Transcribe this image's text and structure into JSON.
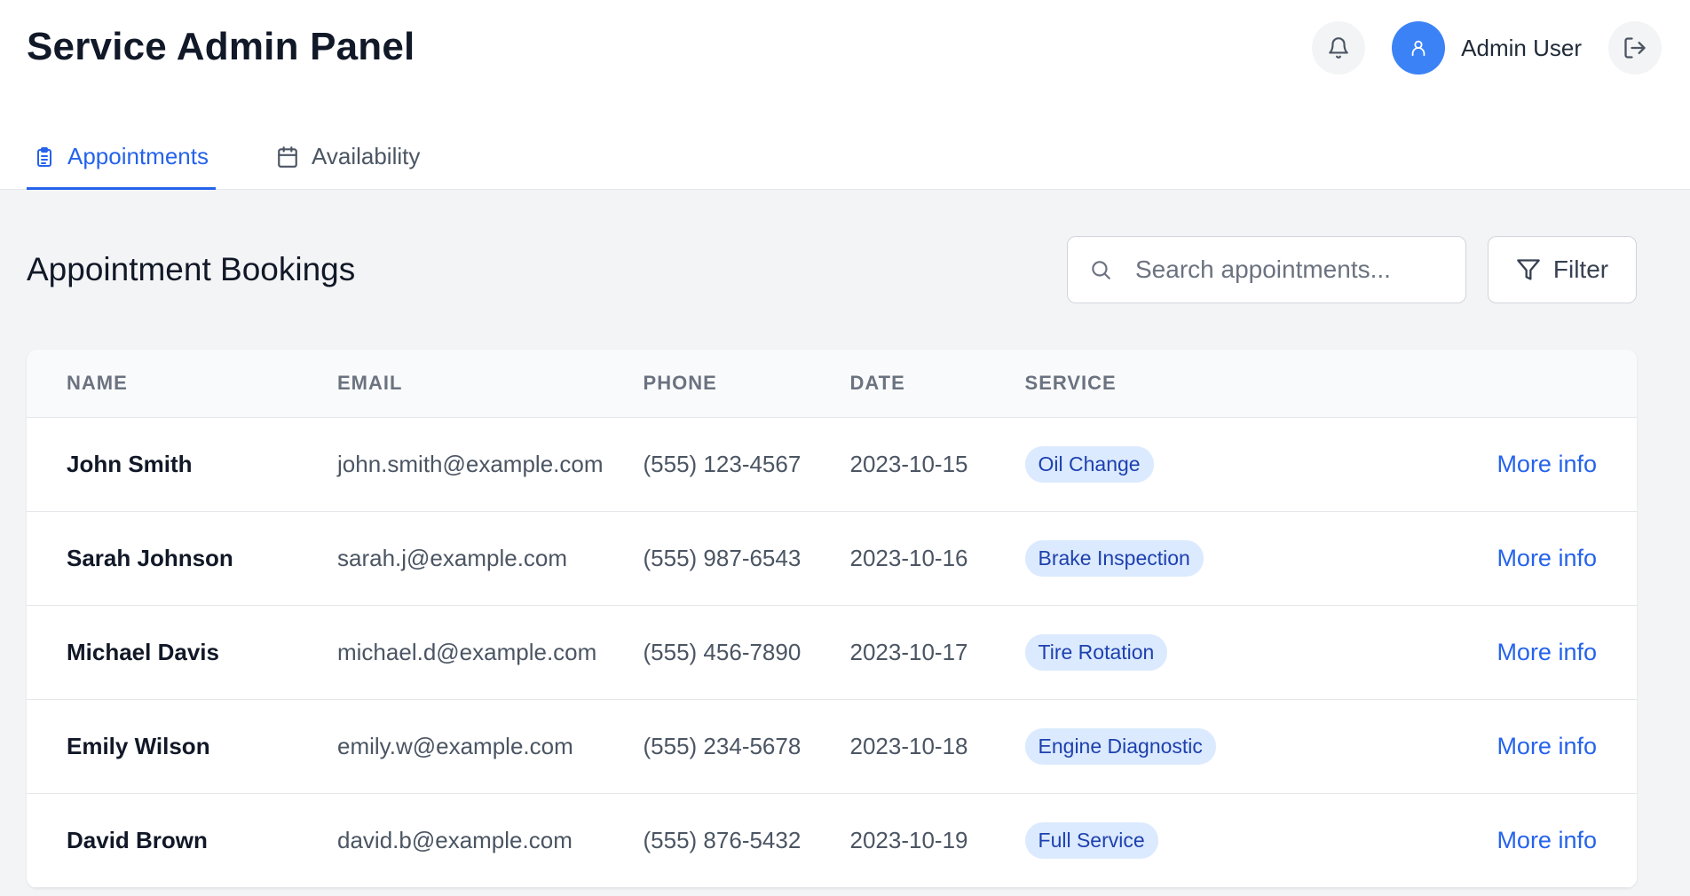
{
  "header": {
    "title": "Service Admin Panel",
    "user_name": "Admin User",
    "bell_icon": "bell-icon",
    "avatar_icon": "user-icon",
    "logout_icon": "logout-icon"
  },
  "tabs": [
    {
      "label": "Appointments",
      "icon": "clipboard-icon",
      "active": true
    },
    {
      "label": "Availability",
      "icon": "calendar-icon",
      "active": false
    }
  ],
  "main": {
    "section_title": "Appointment Bookings",
    "search_placeholder": "Search appointments...",
    "search_value": "",
    "filter_label": "Filter"
  },
  "table": {
    "columns": [
      "NAME",
      "EMAIL",
      "PHONE",
      "DATE",
      "SERVICE",
      ""
    ],
    "rows": [
      {
        "name": "John Smith",
        "email": "john.smith@example.com",
        "phone": "(555) 123-4567",
        "date": "2023-10-15",
        "service": "Oil Change",
        "action": "More info"
      },
      {
        "name": "Sarah Johnson",
        "email": "sarah.j@example.com",
        "phone": "(555) 987-6543",
        "date": "2023-10-16",
        "service": "Brake Inspection",
        "action": "More info"
      },
      {
        "name": "Michael Davis",
        "email": "michael.d@example.com",
        "phone": "(555) 456-7890",
        "date": "2023-10-17",
        "service": "Tire Rotation",
        "action": "More info"
      },
      {
        "name": "Emily Wilson",
        "email": "emily.w@example.com",
        "phone": "(555) 234-5678",
        "date": "2023-10-18",
        "service": "Engine Diagnostic",
        "action": "More info"
      },
      {
        "name": "David Brown",
        "email": "david.b@example.com",
        "phone": "(555) 876-5432",
        "date": "2023-10-19",
        "service": "Full Service",
        "action": "More info"
      }
    ]
  },
  "colors": {
    "accent": "#2563eb",
    "avatar_bg": "#3b82f6",
    "badge_bg": "#dbeafe",
    "badge_text": "#1e40af",
    "page_bg": "#f3f4f6"
  }
}
